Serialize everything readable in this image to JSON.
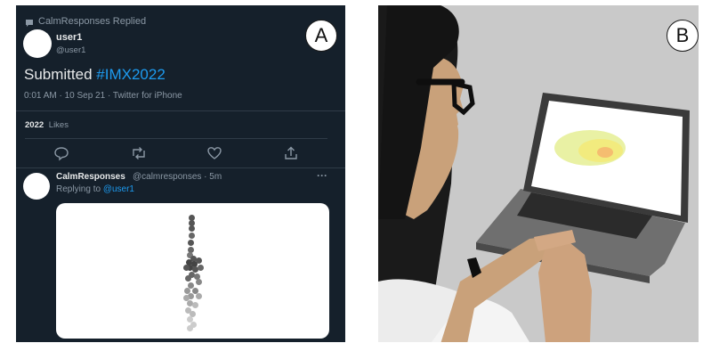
{
  "panel_a": {
    "badge": "A",
    "retweet_context": "CalmResponses Replied",
    "tweet": {
      "user_name": "user1",
      "user_handle": "@user1",
      "text_prefix": "Submitted",
      "hashtag": "#IMX2022",
      "meta": "0:01 AM · 10 Sep 21 · Twitter for iPhone",
      "likes_count": "2022",
      "likes_label": "Likes"
    },
    "actions": [
      "reply-icon",
      "retweet-icon",
      "like-icon",
      "share-icon"
    ],
    "reply": {
      "name": "CalmResponses",
      "handle_time": "@calmresponses · 5m",
      "more": "···",
      "replying_to_label": "Replying to",
      "replying_to_handle": "@user1"
    }
  },
  "panel_b": {
    "badge": "B"
  },
  "colors": {
    "tweet_bg": "#15202b",
    "link": "#1d9bf0",
    "muted": "#8b98a5",
    "text": "#e7e9ea"
  }
}
